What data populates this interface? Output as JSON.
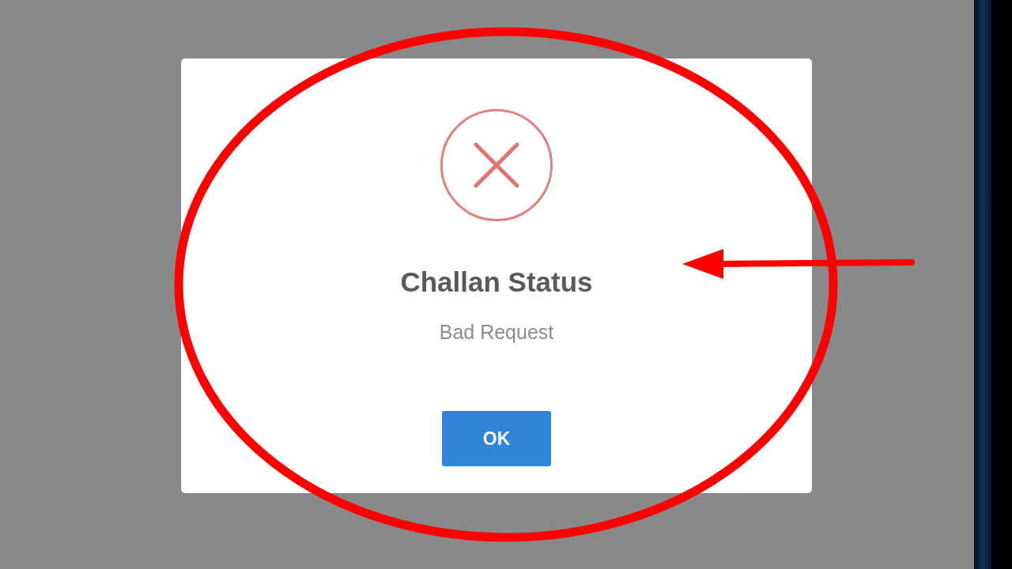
{
  "dialog": {
    "title": "Challan Status",
    "message": "Bad Request",
    "buttons": [
      {
        "label": "OK"
      }
    ]
  }
}
